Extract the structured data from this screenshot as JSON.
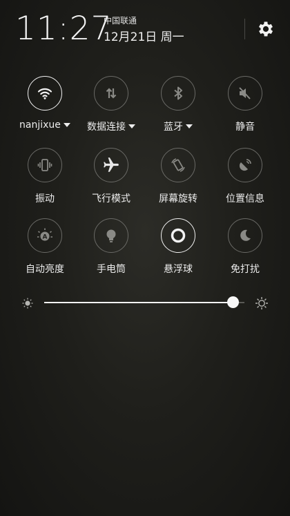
{
  "status": {
    "time": "11:27",
    "carrier": "中国联通",
    "date": "12月21日 周一"
  },
  "tiles": [
    {
      "label": "nanjixue",
      "icon": "wifi-icon",
      "active": true,
      "dropdown": true
    },
    {
      "label": "数据连接",
      "icon": "data-transfer-icon",
      "active": false,
      "dropdown": true
    },
    {
      "label": "蓝牙",
      "icon": "bluetooth-icon",
      "active": false,
      "dropdown": true
    },
    {
      "label": "静音",
      "icon": "mute-icon",
      "active": false,
      "dropdown": false
    },
    {
      "label": "振动",
      "icon": "vibrate-icon",
      "active": false,
      "dropdown": false
    },
    {
      "label": "飞行模式",
      "icon": "airplane-icon",
      "active": false,
      "dropdown": false
    },
    {
      "label": "屏幕旋转",
      "icon": "rotate-icon",
      "active": false,
      "dropdown": false
    },
    {
      "label": "位置信息",
      "icon": "location-icon",
      "active": false,
      "dropdown": false
    },
    {
      "label": "自动亮度",
      "icon": "auto-brightness-icon",
      "active": false,
      "dropdown": false
    },
    {
      "label": "手电筒",
      "icon": "flashlight-icon",
      "active": false,
      "dropdown": false
    },
    {
      "label": "悬浮球",
      "icon": "floating-ball-icon",
      "active": true,
      "dropdown": false
    },
    {
      "label": "免打扰",
      "icon": "moon-icon",
      "active": false,
      "dropdown": false
    }
  ],
  "brightness": {
    "level": 0.94
  },
  "colors": {
    "active": "#f2f2f2",
    "inactive": "#6a6a66",
    "background": "#1f1f1b"
  }
}
